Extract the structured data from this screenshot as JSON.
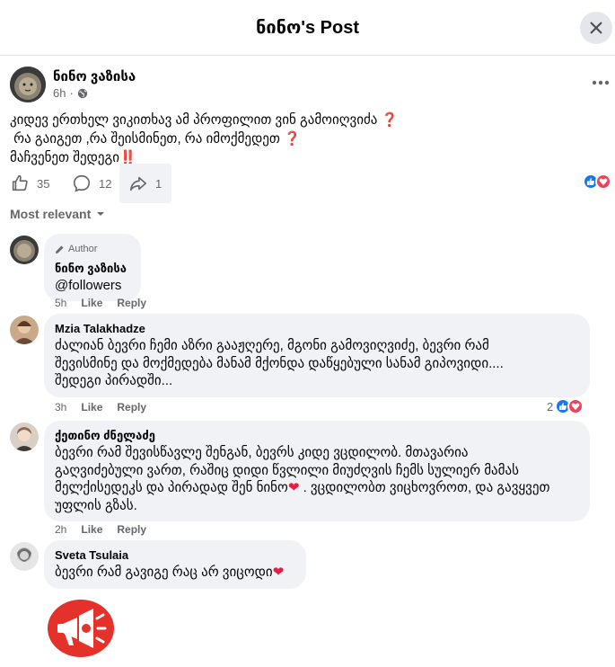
{
  "header": {
    "title": "ნინო's Post"
  },
  "post": {
    "author": "ნინო ვაზისა",
    "time": "6h",
    "lines": [
      "კიდევ ერთხელ ვიკითხავ ამ პროფილით ვინ გამოიღვიძა",
      "რა გაიგეთ ,რა შეისმინეთ, რა იმოქმედეთ",
      "მაჩვენეთ შედეგი"
    ],
    "emojis": [
      "❓",
      "❓",
      "‼️"
    ],
    "likes": "35",
    "comments": "12",
    "shares": "1"
  },
  "sort_label": "Most relevant",
  "comments": [
    {
      "badge": "Author",
      "name": "ნინო ვაზისა",
      "lines": [
        "@followers"
      ],
      "time": "5h",
      "like": "Like",
      "reply": "Reply"
    },
    {
      "name": "Mzia Talakhadze",
      "lines": [
        "ძალიან ბევრი ჩემი აზრი გააჟღერე, მგონი გამოვიღვიძე, ბევრი რამ",
        "შევისმინე და მოქმედება მანამ მქონდა დაწყებული სანამ გიპოვიდი....",
        "შედეგი პირადში..."
      ],
      "time": "3h",
      "like": "Like",
      "reply": "Reply",
      "reactions": "2"
    },
    {
      "name": "ქეთინო ძნელაძე",
      "lines": [
        "ბევრი რამ შევისწავლე შენგან, ბევრს კიდე ვცდილობ. მთავარია",
        "გაღვიძებული ვართ, რაშიც დიდი წვლილი მიუძღვის ჩემს სულიერ მამას",
        "მელქისედეკს და პირადად შენ ნინო",
        ". ვცდილობთ ვიცხოვროთ, და გავყვეთ",
        "უფლის გზას."
      ],
      "time": "2h",
      "like": "Like",
      "reply": "Reply"
    },
    {
      "name": "Sveta Tsulaia",
      "lines": [
        "ბევრი რამ გავიგე რაც არ ვიცოდი"
      ],
      "time": "",
      "like": "",
      "reply": ""
    }
  ],
  "colors": {
    "like_blue": "#1877f2",
    "love_red": "#f33e58",
    "megaphone_red": "#e4322b"
  },
  "icons": [
    "close-icon",
    "globe-icon",
    "more-icon",
    "like-icon",
    "comment-icon",
    "share-icon",
    "pencil-icon",
    "chevron-down-icon",
    "megaphone-icon"
  ]
}
